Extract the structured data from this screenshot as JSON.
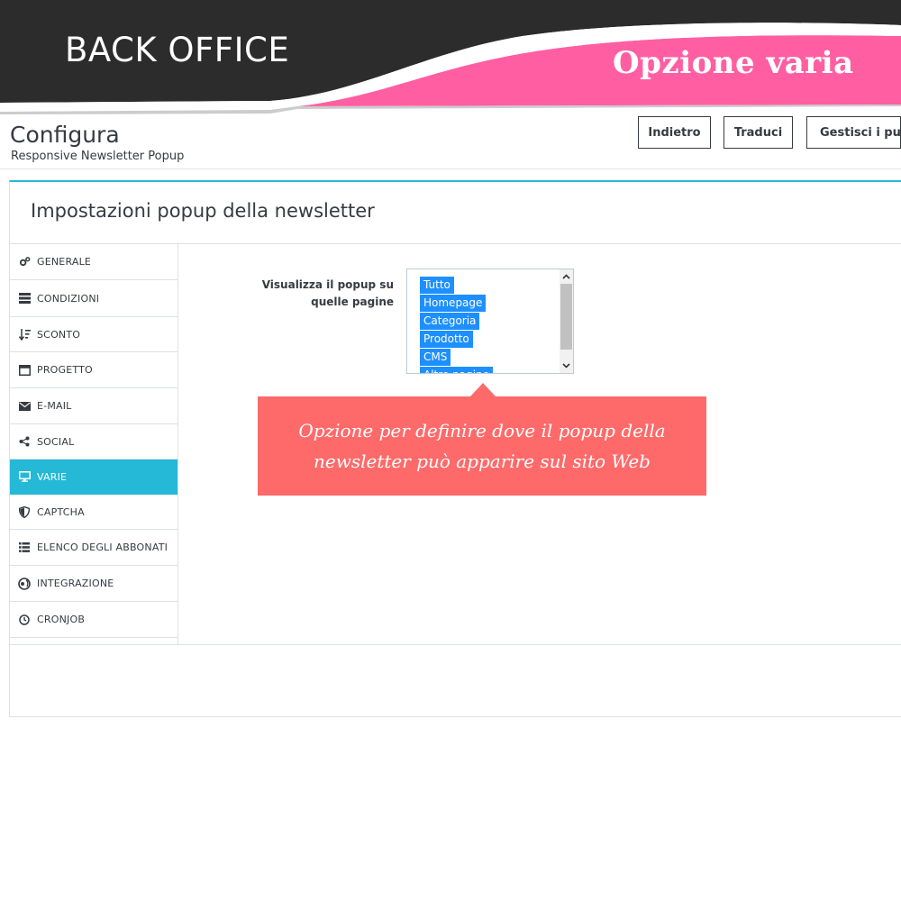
{
  "banner": {
    "left_text": "BACK OFFICE",
    "right_text": "Opzione varia",
    "colors": {
      "dark": "#2b2b2b",
      "pink": "#ff5fa2"
    }
  },
  "header": {
    "title": "Configura",
    "subtitle": "Responsive Newsletter Popup",
    "buttons": [
      "Indietro",
      "Traduci",
      "Gestisci i punti"
    ]
  },
  "panel": {
    "title": "Impostazioni popup della newsletter",
    "accent_color": "#25b9d7"
  },
  "sidemenu": {
    "active_index": 6,
    "items": [
      {
        "label": "GENERALE",
        "icon": "cogs-icon"
      },
      {
        "label": "CONDIZIONI",
        "icon": "list-icon"
      },
      {
        "label": "SCONTO",
        "icon": "sort-icon"
      },
      {
        "label": "PROGETTO",
        "icon": "window-icon"
      },
      {
        "label": "E-MAIL",
        "icon": "envelope-icon"
      },
      {
        "label": "SOCIAL",
        "icon": "share-icon"
      },
      {
        "label": "VARIE",
        "icon": "desktop-icon"
      },
      {
        "label": "CAPTCHA",
        "icon": "shield-icon"
      },
      {
        "label": "ELENCO DEGLI ABBONATI",
        "icon": "list-lines-icon"
      },
      {
        "label": "INTEGRAZIONE",
        "icon": "mailchimp-icon"
      },
      {
        "label": "CRONJOB",
        "icon": "clock-icon"
      }
    ]
  },
  "form": {
    "label": "Visualizza il popup su quelle pagine",
    "options": [
      "Tutto",
      "Homepage",
      "Categoria",
      "Prodotto",
      "CMS",
      "Altre pagine"
    ],
    "selection_color": "#1e8fff"
  },
  "tooltip": {
    "text": "Opzione per definire dove il popup della newsletter può apparire sul sito Web",
    "color": "#fe6a6a"
  }
}
